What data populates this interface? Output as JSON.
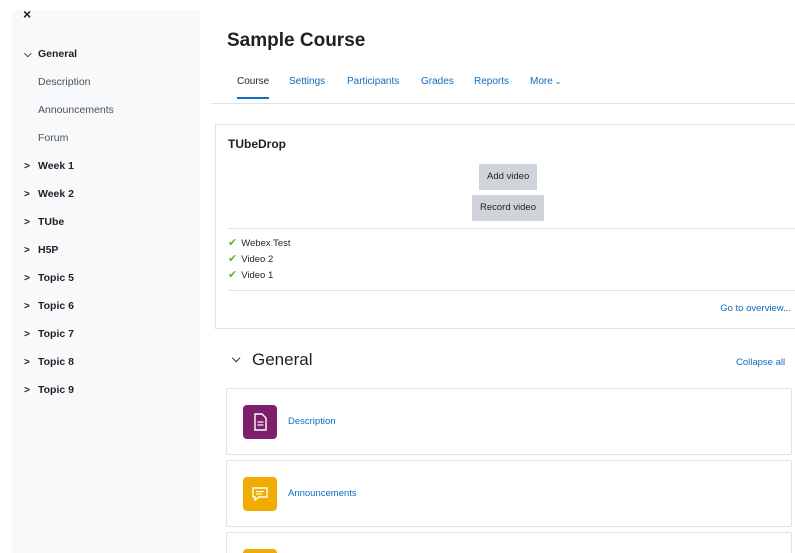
{
  "drawer": {
    "close_label": "×",
    "items": [
      {
        "label": "General",
        "type": "section",
        "expanded": true
      },
      {
        "label": "Description",
        "type": "child"
      },
      {
        "label": "Announcements",
        "type": "child"
      },
      {
        "label": "Forum",
        "type": "child"
      },
      {
        "label": "Week 1",
        "type": "section"
      },
      {
        "label": "Week 2",
        "type": "section"
      },
      {
        "label": "TUbe",
        "type": "section"
      },
      {
        "label": "H5P",
        "type": "section"
      },
      {
        "label": "Topic 5",
        "type": "section"
      },
      {
        "label": "Topic 6",
        "type": "section"
      },
      {
        "label": "Topic 7",
        "type": "section"
      },
      {
        "label": "Topic 8",
        "type": "section"
      },
      {
        "label": "Topic 9",
        "type": "section"
      }
    ]
  },
  "course": {
    "title": "Sample Course",
    "tabs": [
      {
        "label": "Course",
        "active": true
      },
      {
        "label": "Settings"
      },
      {
        "label": "Participants"
      },
      {
        "label": "Grades"
      },
      {
        "label": "Reports"
      },
      {
        "label": "More"
      }
    ]
  },
  "tubedrop": {
    "title": "TUbeDrop",
    "add_video_label": "Add video",
    "record_video_label": "Record video",
    "videos": [
      "Webex Test",
      "Video 2",
      "Video 1"
    ],
    "overview_link": "Go to overview..."
  },
  "section": {
    "title": "General",
    "collapse_all_label": "Collapse all",
    "activities": [
      {
        "name": "Description",
        "icon": "page-icon",
        "color": "#7d1f6b"
      },
      {
        "name": "Announcements",
        "icon": "forum-icon",
        "color": "#f0ad00"
      },
      {
        "name": "",
        "icon": "forum-icon",
        "color": "#f0ad00"
      }
    ]
  },
  "colors": {
    "link": "#0f6cbf",
    "drawer_bg": "#f8f9fa",
    "check": "#6ab13d"
  }
}
